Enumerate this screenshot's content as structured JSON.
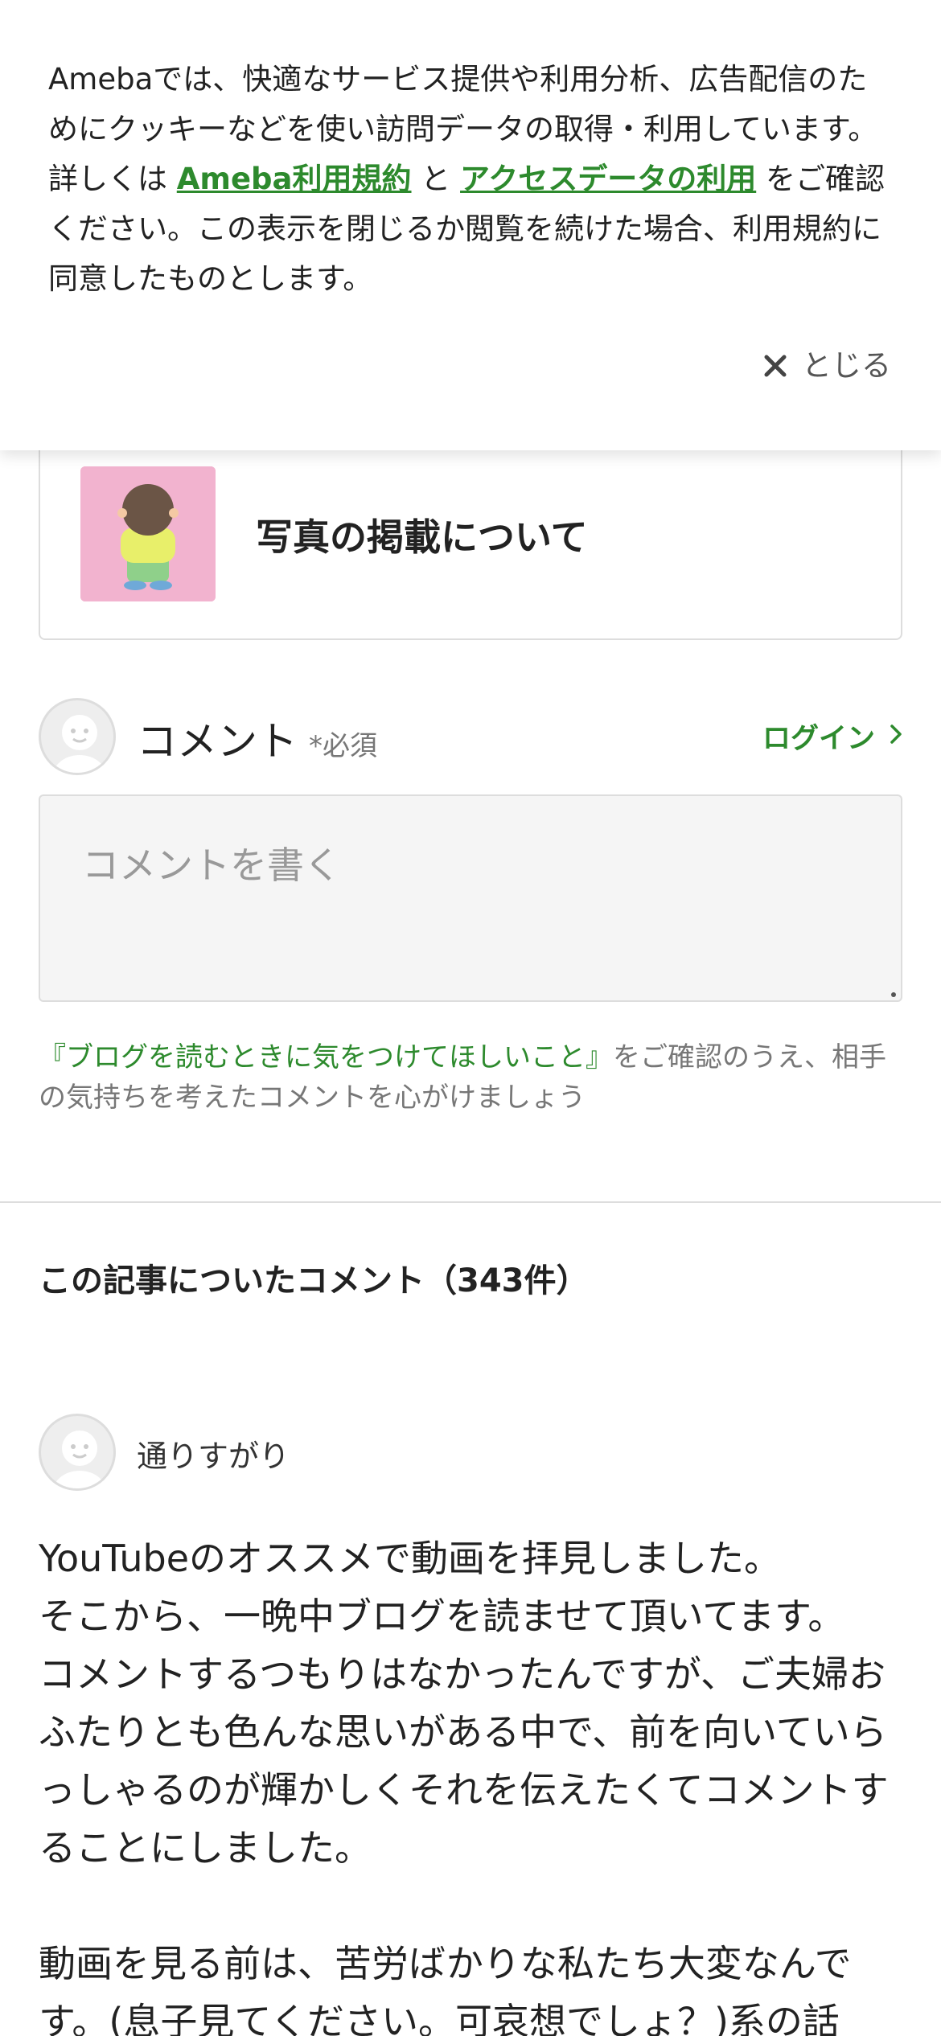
{
  "cookie_banner": {
    "text_part1": "Amebaでは、快適なサービス提供や利用分析、広告配信のためにクッキーなどを使い訪問データの取得・利用しています。詳しくは ",
    "link_terms": "Ameba利用規約",
    "text_part2": " と ",
    "link_access_data": "アクセスデータの利用",
    "text_part3": " をご確認ください。この表示を閉じるか閲覧を続けた場合、利用規約に同意したものとします。",
    "close_label": "とじる"
  },
  "article_card": {
    "title": "写真の掲載について"
  },
  "comment_form": {
    "label": "コメント",
    "required": "*必須",
    "login_label": "ログイン",
    "placeholder": "コメントを書く",
    "guide_link": "『ブログを読むときに気をつけてほしいこと』",
    "guide_text": "をご確認のうえ、相手の気持ちを考えたコメントを心がけましょう"
  },
  "comments_section": {
    "heading": "この記事についたコメント（343件）",
    "items": [
      {
        "name": "通りすがり",
        "body": "YouTubeのオススメで動画を拝見しました。\nそこから、一晩中ブログを読ませて頂いてます。\nコメントするつもりはなかったんですが、ご夫婦おふたりとも色んな思いがある中で、前を向いていらっしゃるのが輝かしくそれを伝えたくてコメントすることにしました。\n\n動画を見る前は、苦労ばかりな私たち大変なんです。(息子見てください。可哀想でしょ？)系の話"
      }
    ]
  },
  "colors": {
    "accent_green": "#2d8a2d",
    "thumbnail_bg": "#f2b3cf",
    "input_bg": "#f5f5f5"
  },
  "icons": {
    "close": "close-icon",
    "chevron": "chevron-right-icon",
    "avatar": "default-avatar-icon"
  }
}
